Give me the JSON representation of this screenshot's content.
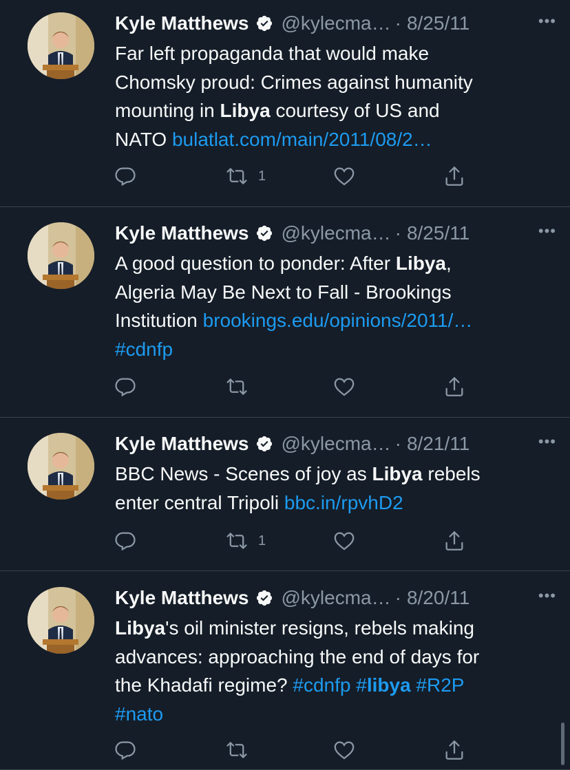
{
  "colors": {
    "background": "#151d28",
    "link": "#1d9bf0",
    "muted": "#8b98a5",
    "divider": "#38444d"
  },
  "tweets": [
    {
      "name": "Kyle Matthews",
      "handle": "@kylecma…",
      "sep": "·",
      "date": "8/25/11",
      "more": "•••",
      "lines": [
        [
          {
            "t": "Far left propaganda that would make"
          }
        ],
        [
          {
            "t": "Chomsky proud: Crimes against humanity"
          }
        ],
        [
          {
            "t": "mounting in "
          },
          {
            "t": "Libya",
            "b": true
          },
          {
            "t": " courtesy of US and"
          }
        ],
        [
          {
            "t": "NATO "
          },
          {
            "t": "bulatlat.com/main/2011/08/2…",
            "link": true
          }
        ]
      ],
      "retweets": "1"
    },
    {
      "name": "Kyle Matthews",
      "handle": "@kylecma…",
      "sep": "·",
      "date": "8/25/11",
      "more": "•••",
      "lines": [
        [
          {
            "t": "A good question to ponder: After "
          },
          {
            "t": "Libya",
            "b": true
          },
          {
            "t": ","
          }
        ],
        [
          {
            "t": "Algeria May Be Next to Fall - Brookings"
          }
        ],
        [
          {
            "t": "Institution "
          },
          {
            "t": "brookings.edu/opinions/2011/…",
            "link": true
          }
        ],
        [
          {
            "t": "#cdnfp",
            "link": true
          }
        ]
      ],
      "retweets": ""
    },
    {
      "name": "Kyle Matthews",
      "handle": "@kylecma…",
      "sep": "·",
      "date": "8/21/11",
      "more": "•••",
      "lines": [
        [
          {
            "t": "BBC News - Scenes of joy as "
          },
          {
            "t": "Libya",
            "b": true
          },
          {
            "t": " rebels"
          }
        ],
        [
          {
            "t": "enter central Tripoli "
          },
          {
            "t": "bbc.in/rpvhD2",
            "link": true
          }
        ]
      ],
      "retweets": "1"
    },
    {
      "name": "Kyle Matthews",
      "handle": "@kylecma…",
      "sep": "·",
      "date": "8/20/11",
      "more": "•••",
      "lines": [
        [
          {
            "t": "Libya",
            "b": true
          },
          {
            "t": "'s oil minister resigns, rebels making"
          }
        ],
        [
          {
            "t": "advances: approaching the end of days for"
          }
        ],
        [
          {
            "t": "the Khadafi regime? "
          },
          {
            "t": "#cdnfp",
            "link": true
          },
          {
            "t": " "
          },
          {
            "t": "#",
            "link": true
          },
          {
            "t": "libya",
            "link": true,
            "b": true
          },
          {
            "t": " "
          },
          {
            "t": "#R2P",
            "link": true
          }
        ],
        [
          {
            "t": "#nato",
            "link": true
          }
        ]
      ],
      "retweets": ""
    }
  ]
}
